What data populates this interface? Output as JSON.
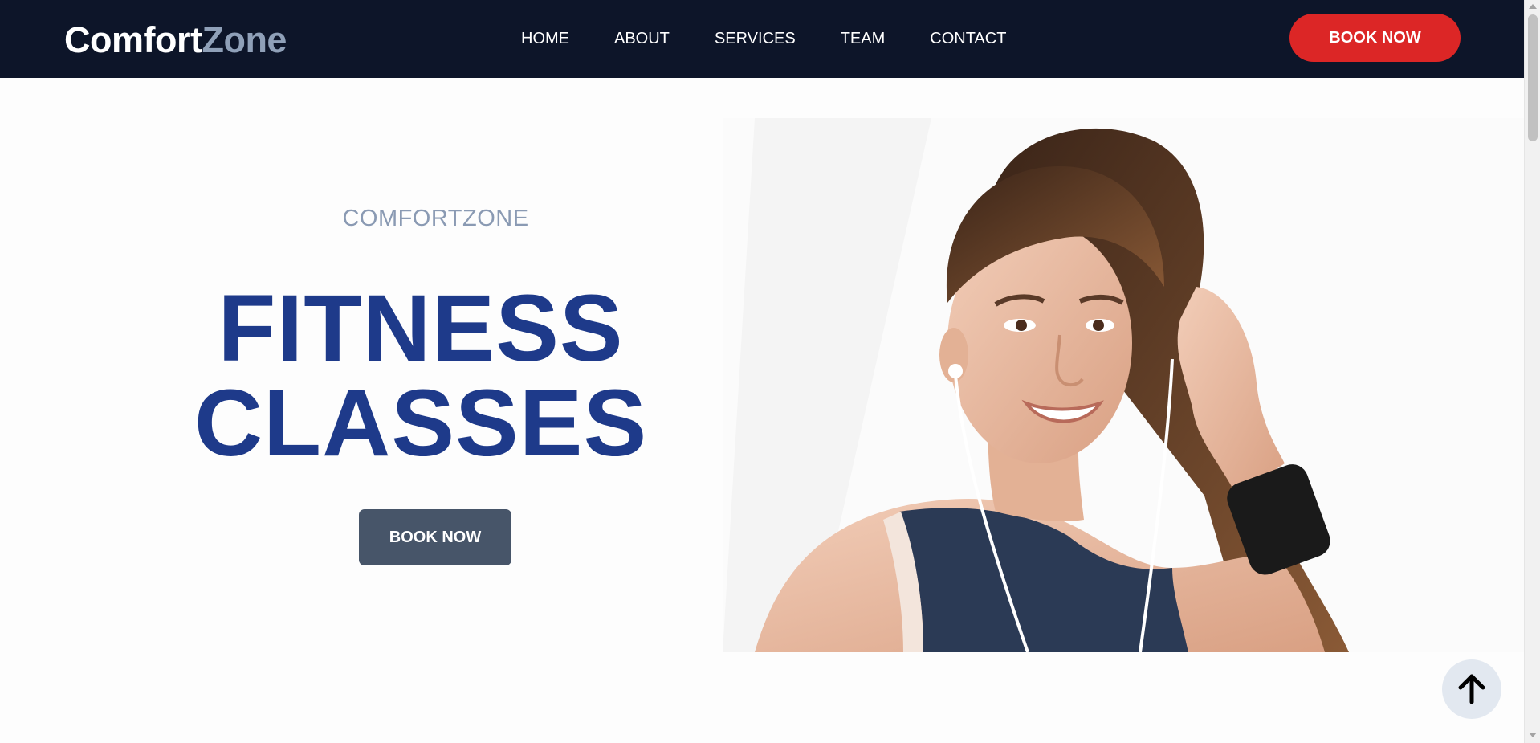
{
  "nav": {
    "logo_part1": "Comfort",
    "logo_part2": "Zone",
    "links": [
      "HOME",
      "ABOUT",
      "SERVICES",
      "TEAM",
      "CONTACT"
    ],
    "book_button": "BOOK NOW"
  },
  "hero": {
    "subtitle": "COMFORTZONE",
    "title_line1": "FITNESS",
    "title_line2": "CLASSES",
    "book_button": "BOOK NOW"
  },
  "colors": {
    "nav_bg": "#0d1529",
    "accent_red": "#dc2626",
    "title_blue": "#1e3a8a",
    "logo_muted": "#8fa0b8",
    "hero_button": "#475569"
  },
  "icons": {
    "scroll_top": "arrow-up-icon"
  }
}
